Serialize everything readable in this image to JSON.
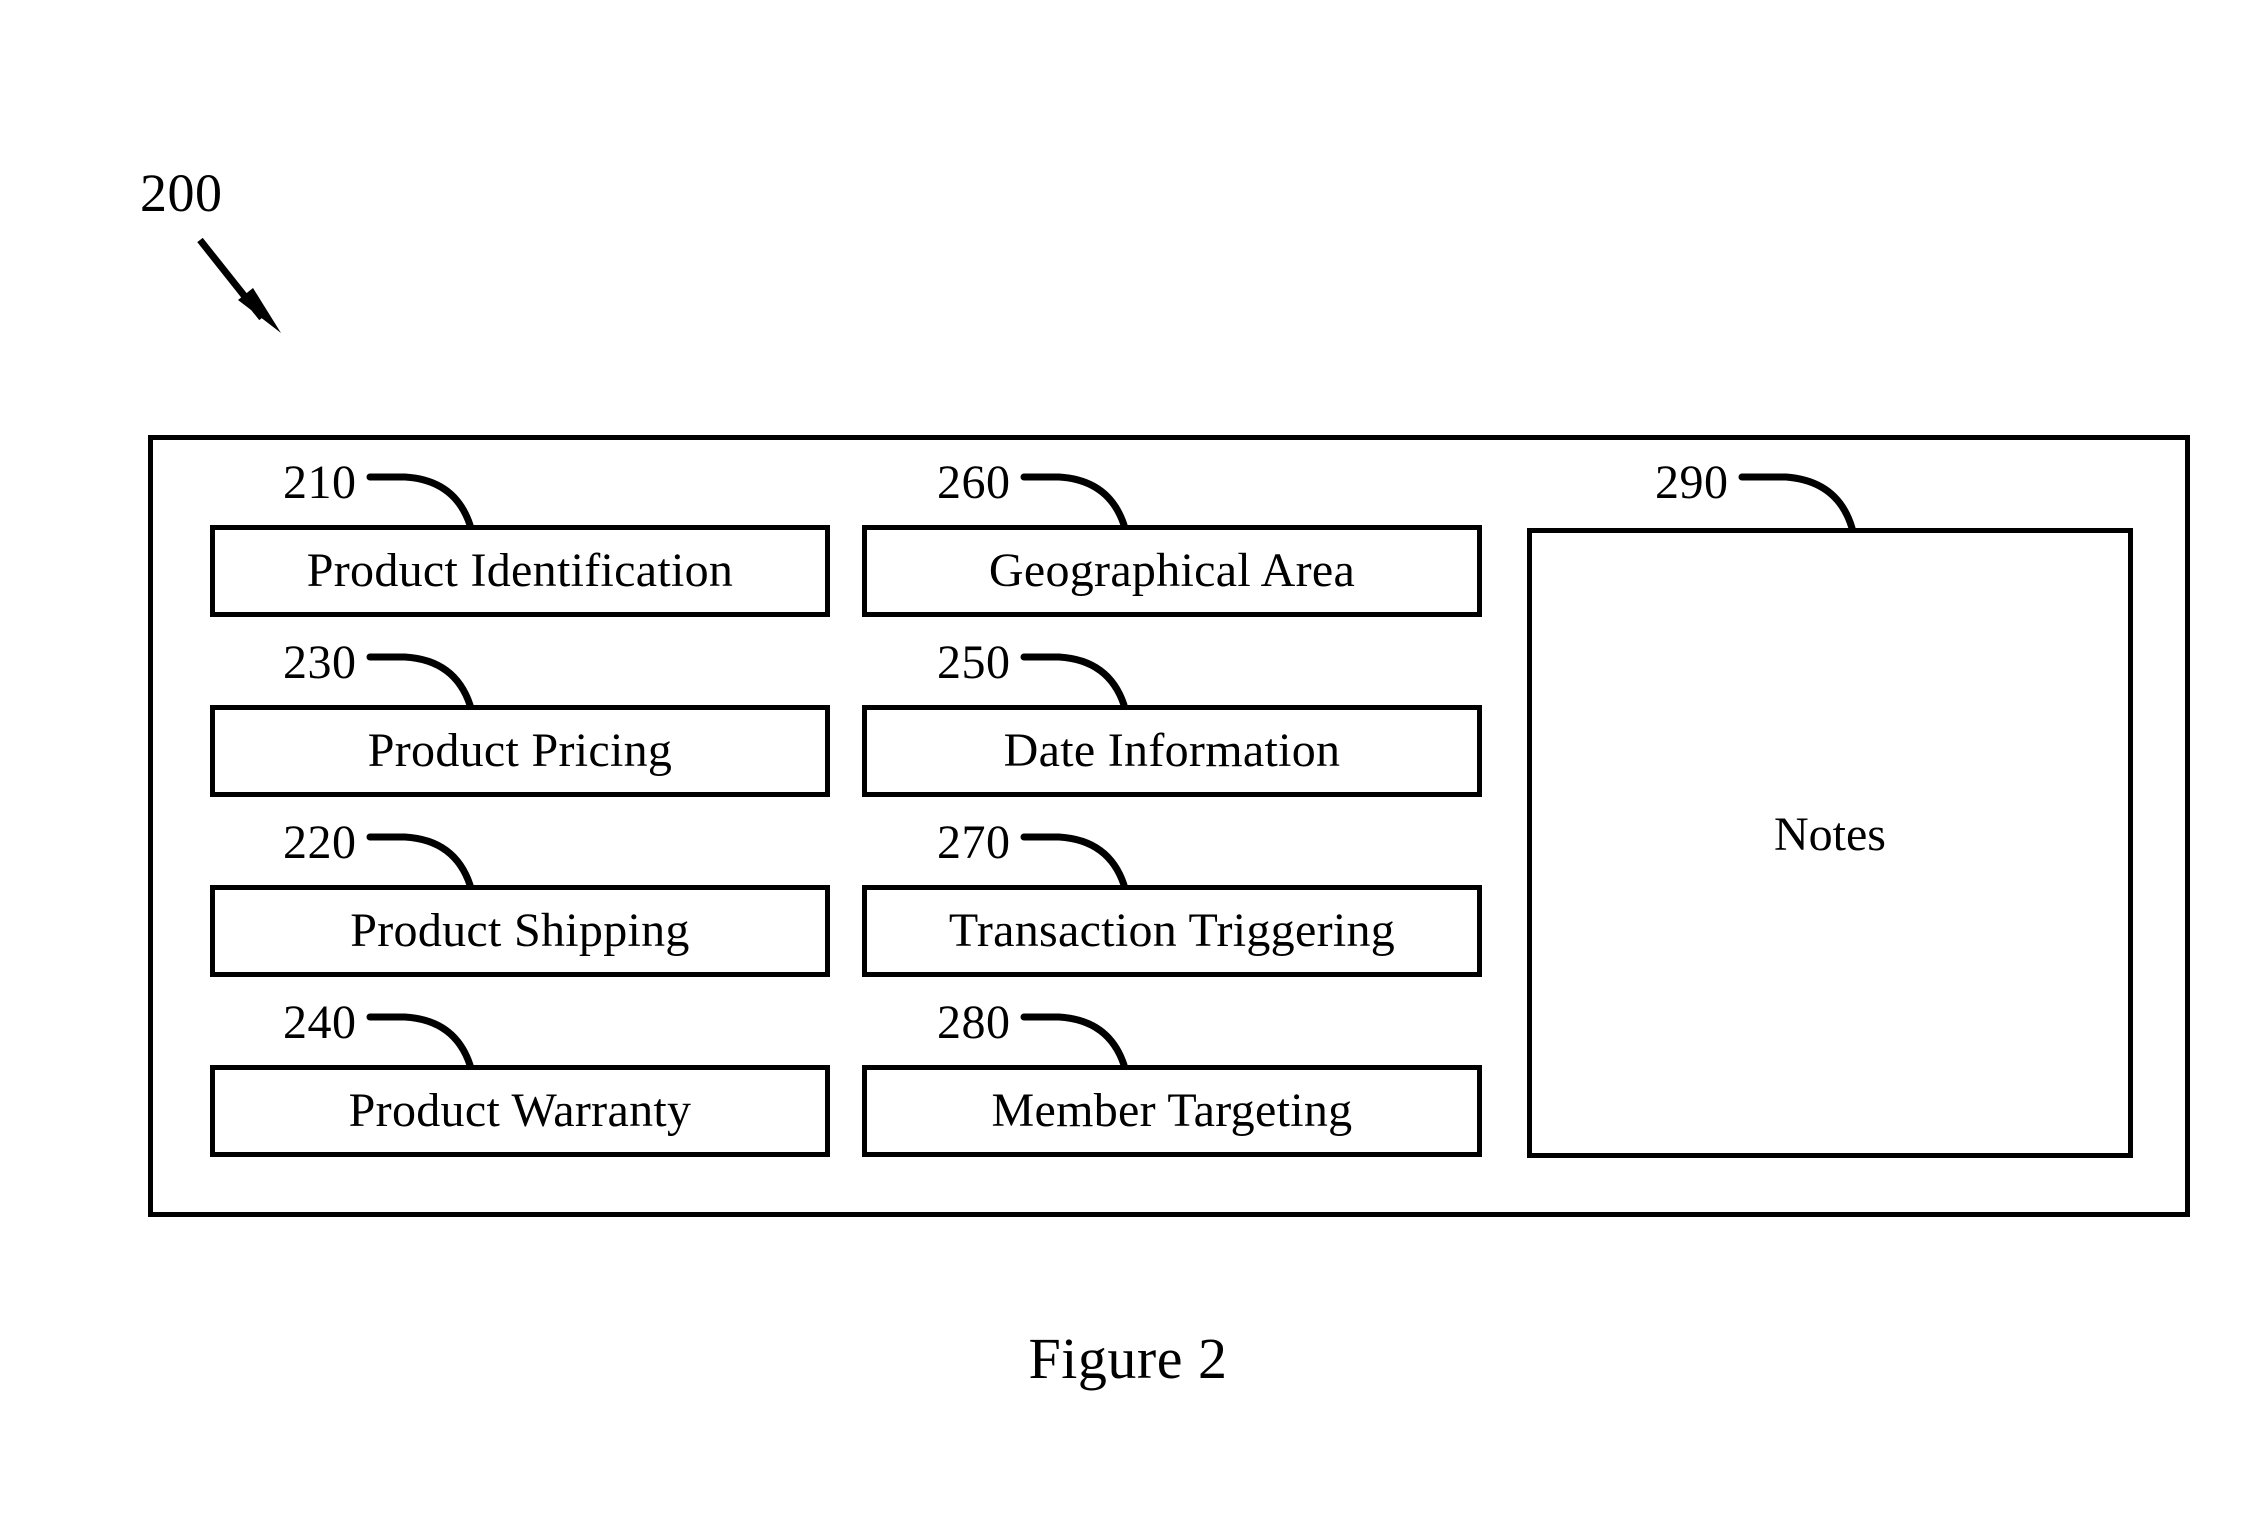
{
  "figure": {
    "caption": "Figure 2",
    "root_reference": "200"
  },
  "container": {
    "reference": "200",
    "columns": [
      {
        "name": "column-one",
        "boxes": [
          {
            "reference": "210",
            "label": "Product Identification"
          },
          {
            "reference": "230",
            "label": "Product Pricing"
          },
          {
            "reference": "220",
            "label": "Product Shipping"
          },
          {
            "reference": "240",
            "label": "Product Warranty"
          }
        ]
      },
      {
        "name": "column-two",
        "boxes": [
          {
            "reference": "260",
            "label": "Geographical Area"
          },
          {
            "reference": "250",
            "label": "Date Information"
          },
          {
            "reference": "270",
            "label": "Transaction Triggering"
          },
          {
            "reference": "280",
            "label": "Member Targeting"
          }
        ]
      }
    ],
    "notes_panel": {
      "reference": "290",
      "label": "Notes"
    }
  },
  "style": {
    "stroke_color": "#000000",
    "background_color": "#ffffff"
  }
}
